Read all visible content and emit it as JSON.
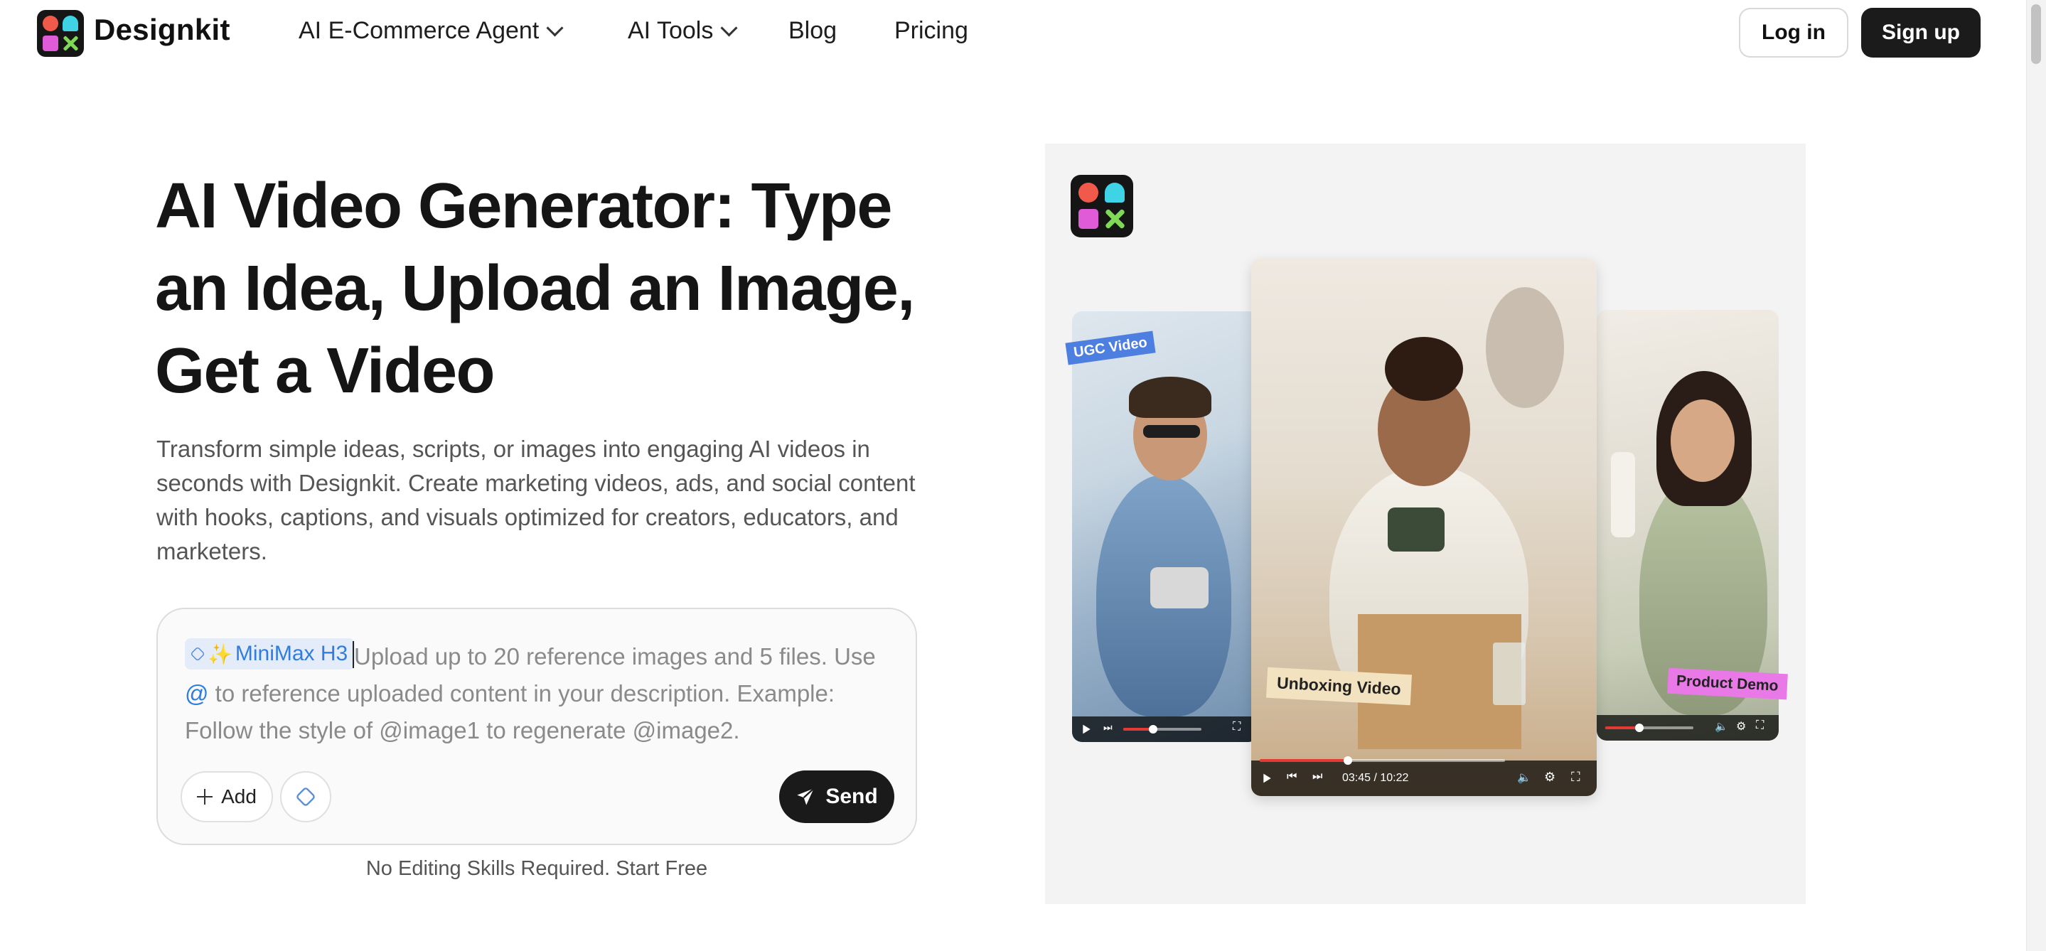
{
  "nav": {
    "brand": "Designkit",
    "items": [
      {
        "label": "AI E-Commerce Agent",
        "has_dropdown": true
      },
      {
        "label": "AI Tools",
        "has_dropdown": true
      },
      {
        "label": "Blog",
        "has_dropdown": false
      },
      {
        "label": "Pricing",
        "has_dropdown": false
      }
    ],
    "login_label": "Log in",
    "signup_label": "Sign up"
  },
  "hero": {
    "title": "AI Video Generator: Type an Idea, Upload an Image, Get a Video",
    "description": "Transform simple ideas, scripts, or images into engaging AI videos in seconds with Designkit. Create marketing videos, ads, and social content with hooks, captions, and visuals optimized for creators, educators, and marketers.",
    "prompt": {
      "model_chip": "MiniMax H3",
      "placeholder_part1": "Upload up to 20 reference images and 5 files. Use ",
      "placeholder_at": "@",
      "placeholder_part2": " to reference uploaded content in your description. Example: Follow the style of @image1 to regenerate @image2.",
      "add_label": "Add",
      "send_label": "Send"
    },
    "sub_note": "No Editing Skills Required. Start Free"
  },
  "preview": {
    "tags": {
      "ugc": "UGC Video",
      "unboxing": "Unboxing Video",
      "demo": "Product Demo"
    },
    "center_video_time": "03:45 / 10:22",
    "center_video_progress": 0.36
  },
  "colors": {
    "accent_blue": "#2f7de0",
    "dark": "#1a1a1a",
    "logo_red": "#f15a4a",
    "logo_cyan": "#3fd3e6",
    "logo_pink": "#e05bd8",
    "logo_green": "#7fd957"
  }
}
